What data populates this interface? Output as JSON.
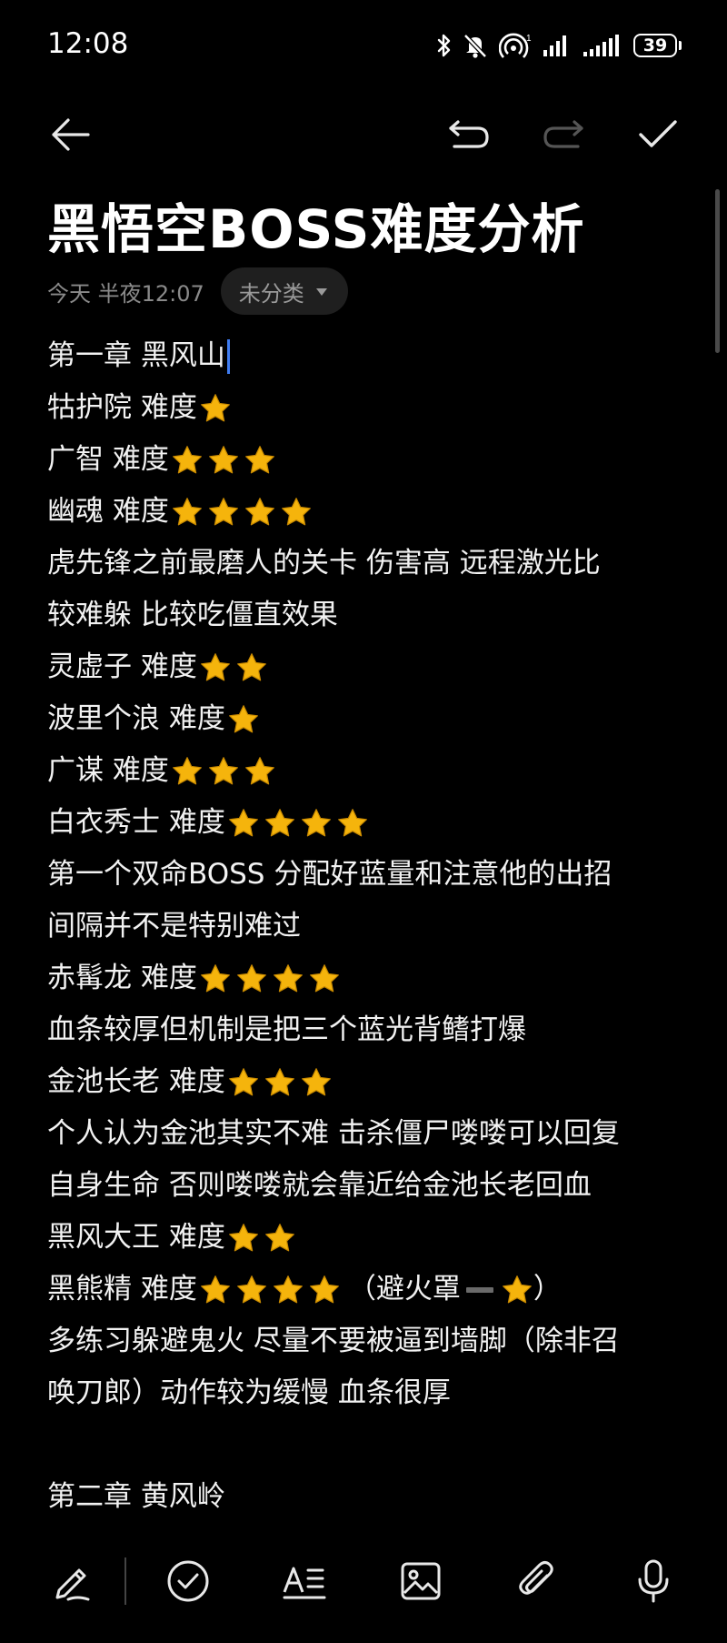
{
  "status_bar": {
    "time": "12:08",
    "battery": "39"
  },
  "title": "黑悟空BOSS难度分析",
  "meta": {
    "date": "今天 半夜12:07",
    "category": "未分类"
  },
  "lines": [
    {
      "text": "第一章 黑风山",
      "stars": 0,
      "cursor": true
    },
    {
      "text": "牯护院 难度",
      "stars": 1
    },
    {
      "text": "广智 难度",
      "stars": 3
    },
    {
      "text": "幽魂 难度",
      "stars": 4
    },
    {
      "text": "虎先锋之前最磨人的关卡 伤害高 远程激光比",
      "stars": 0
    },
    {
      "text": "较难躲 比较吃僵直效果",
      "stars": 0
    },
    {
      "text": "灵虚子 难度",
      "stars": 2
    },
    {
      "text": "波里个浪 难度",
      "stars": 1
    },
    {
      "text": "广谋 难度",
      "stars": 3
    },
    {
      "text": "白衣秀士 难度",
      "stars": 4
    },
    {
      "text": "第一个双命BOSS 分配好蓝量和注意他的出招",
      "stars": 0
    },
    {
      "text": "间隔并不是特别难过",
      "stars": 0
    },
    {
      "text": "赤髯龙 难度",
      "stars": 4
    },
    {
      "text": "血条较厚但机制是把三个蓝光背鳍打爆",
      "stars": 0
    },
    {
      "text": "金池长老 难度",
      "stars": 3
    },
    {
      "text": "个人认为金池其实不难 击杀僵尸喽喽可以回复",
      "stars": 0
    },
    {
      "text": "自身生命 否则喽喽就会靠近给金池长老回血",
      "stars": 0
    },
    {
      "text": "黑风大王 难度",
      "stars": 2
    },
    {
      "text": "黑熊精 难度",
      "stars": 4,
      "suffix_open": "（避火罩",
      "suffix_stars": 1,
      "suffix_close": "）"
    },
    {
      "text": "多练习躲避鬼火 尽量不要被逼到墙脚（除非召",
      "stars": 0
    },
    {
      "text": "唤刀郎）动作较为缓慢 血条很厚",
      "stars": 0
    },
    {
      "blank": true
    },
    {
      "text": "第二章 黄风岭",
      "stars": 0
    }
  ],
  "colors": {
    "star": "#f5b40c",
    "caret": "#3f7cf0",
    "background": "#000000"
  },
  "icons": {
    "toolbar": [
      "back-arrow-icon",
      "undo-icon",
      "redo-icon",
      "check-icon"
    ],
    "bottom": [
      "pen-icon",
      "checklist-icon",
      "text-format-icon",
      "image-icon",
      "attachment-icon",
      "microphone-icon"
    ]
  }
}
